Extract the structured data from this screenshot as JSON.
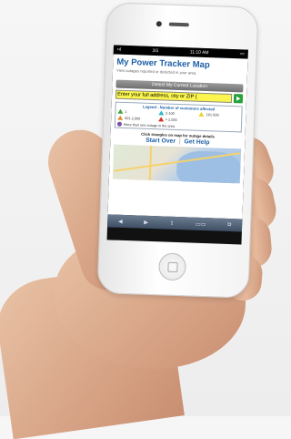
{
  "phone": {
    "status": {
      "signal": "•ıl",
      "carrier": "3G",
      "time": "11:10 AM",
      "battery": "▭"
    },
    "app": {
      "title": "My Power Tracker Map",
      "subtitle": "View outages reported or detected in your area.",
      "detect_button": "Detect My Current Location",
      "search": {
        "value": "Enter your full address, city or ZIP (",
        "go_icon": "play-arrow-icon"
      },
      "legend": {
        "title": "Legend - Number of customers affected",
        "items": [
          {
            "label": "1",
            "color": "#3aa43a"
          },
          {
            "label": "2-100",
            "color": "#2bb7c9"
          },
          {
            "label": "101-500",
            "color": "#e8d431"
          },
          {
            "label": "501-2,000",
            "color": "#e78a2b"
          },
          {
            "label": "> 2,000",
            "color": "#d52b20"
          }
        ],
        "more": "More than one outage in the area"
      },
      "hint": "Click triangles on map for outage details",
      "links": {
        "start_over": "Start Over",
        "separator": "|",
        "get_help": "Get Help"
      }
    },
    "toolbar": {
      "back": "◀",
      "forward": "▶",
      "share": "⇪",
      "bookmarks": "▭▭",
      "tabs": "⧉"
    }
  }
}
